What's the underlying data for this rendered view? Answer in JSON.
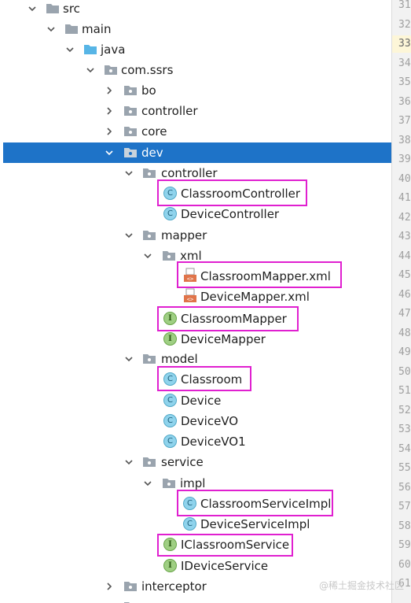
{
  "tree": {
    "src": "src",
    "main": "main",
    "java": "java",
    "com_ssrs": "com.ssrs",
    "bo": "bo",
    "controller": "controller",
    "core": "core",
    "dev": "dev",
    "dev_controller": "controller",
    "classroom_controller": "ClassroomController",
    "device_controller": "DeviceController",
    "mapper": "mapper",
    "xml": "xml",
    "classroom_mapper_xml": "ClassroomMapper.xml",
    "device_mapper_xml": "DeviceMapper.xml",
    "classroom_mapper": "ClassroomMapper",
    "device_mapper": "DeviceMapper",
    "model": "model",
    "classroom": "Classroom",
    "device": "Device",
    "device_vo": "DeviceVO",
    "device_vo1": "DeviceVO1",
    "service": "service",
    "impl": "impl",
    "classroom_service_impl": "ClassroomServiceImpl",
    "device_service_impl": "DeviceServiceImpl",
    "iclassroom_service": "IClassroomService",
    "idevice_service": "IDeviceService",
    "interceptor": "interceptor"
  },
  "icons": {
    "class_letter": "C",
    "interface_letter": "I"
  },
  "gutter": {
    "lines": [
      "31",
      "32",
      "33",
      "34",
      "35",
      "36",
      "37",
      "38",
      "39",
      "40",
      "41",
      "42",
      "43",
      "44",
      "45",
      "46",
      "47",
      "48",
      "49",
      "50",
      "51",
      "52",
      "53",
      "54",
      "55",
      "56",
      "57",
      "58",
      "59",
      "60",
      "61"
    ],
    "current_line": "33"
  },
  "watermark": "@稀土掘金技术社区",
  "colors": {
    "selection": "#1e73c8",
    "highlight_box": "#e020d0",
    "class_icon": "#8fd3ec",
    "interface_icon": "#9fcf83",
    "folder": "#9aa4ae"
  }
}
